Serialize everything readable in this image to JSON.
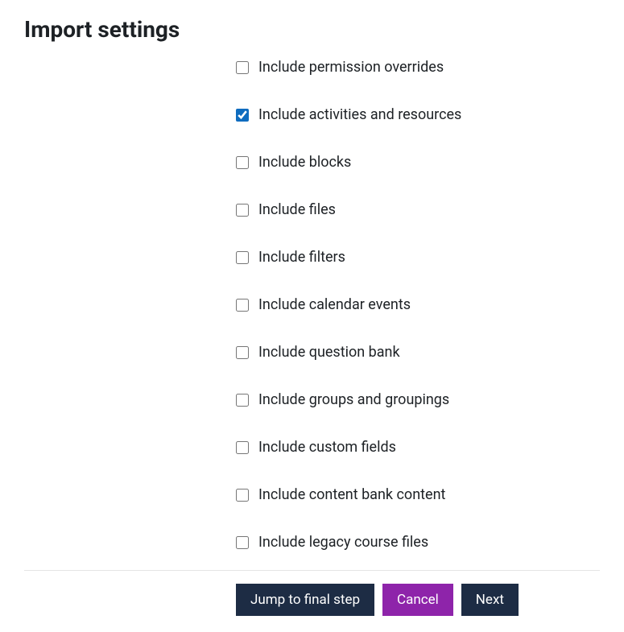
{
  "heading": "Import settings",
  "checkboxes": [
    {
      "id": "permission-overrides",
      "label": "Include permission overrides",
      "checked": false
    },
    {
      "id": "activities-resources",
      "label": "Include activities and resources",
      "checked": true
    },
    {
      "id": "blocks",
      "label": "Include blocks",
      "checked": false
    },
    {
      "id": "files",
      "label": "Include files",
      "checked": false
    },
    {
      "id": "filters",
      "label": "Include filters",
      "checked": false
    },
    {
      "id": "calendar-events",
      "label": "Include calendar events",
      "checked": false
    },
    {
      "id": "question-bank",
      "label": "Include question bank",
      "checked": false
    },
    {
      "id": "groups-groupings",
      "label": "Include groups and groupings",
      "checked": false
    },
    {
      "id": "custom-fields",
      "label": "Include custom fields",
      "checked": false
    },
    {
      "id": "content-bank",
      "label": "Include content bank content",
      "checked": false
    },
    {
      "id": "legacy-course-files",
      "label": "Include legacy course files",
      "checked": false
    }
  ],
  "buttons": {
    "jump": "Jump to final step",
    "cancel": "Cancel",
    "next": "Next"
  }
}
